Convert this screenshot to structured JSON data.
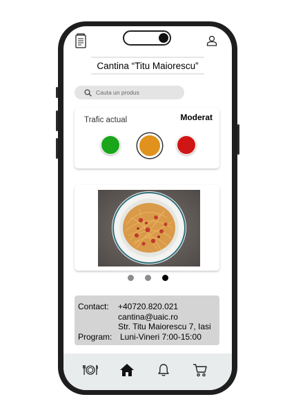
{
  "header": {
    "title": "Cantina “Titu Maiorescu”"
  },
  "search": {
    "placeholder": "Cauta un produs"
  },
  "traffic": {
    "label": "Trafic actual",
    "status": "Moderat",
    "lights": [
      {
        "color": "#1aa61a",
        "active": false
      },
      {
        "color": "#e0921c",
        "active": true
      },
      {
        "color": "#d01515",
        "active": false
      }
    ]
  },
  "carousel": {
    "page_count": 3,
    "active_index": 2
  },
  "contact": {
    "contact_label": "Contact:",
    "phone": "+40720.820.021",
    "email": "cantina@uaic.ro",
    "address": "Str. Titu Maiorescu 7, Iasi",
    "program_label": "Program:",
    "program_value": "Luni-Vineri 7:00-15:00"
  },
  "nav": {
    "items": [
      "menu-icon",
      "home-icon",
      "bell-icon",
      "cart-icon"
    ],
    "active": "home-icon"
  }
}
